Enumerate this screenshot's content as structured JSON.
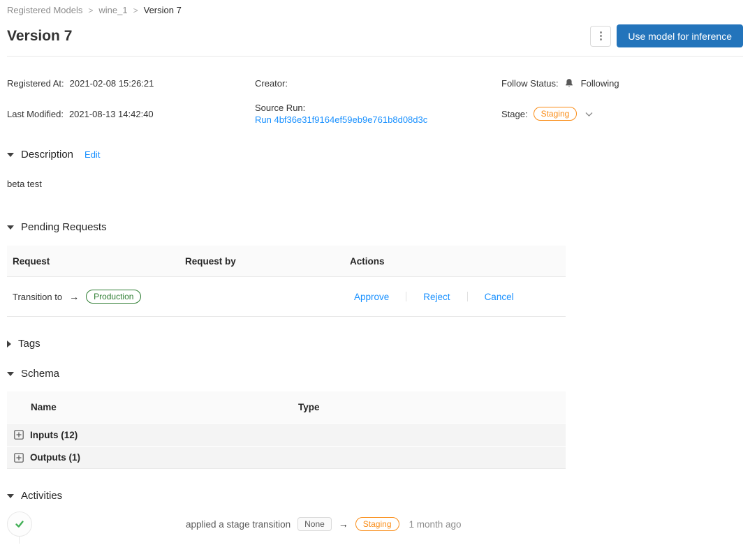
{
  "breadcrumb": {
    "separator": ">",
    "items": [
      {
        "label": "Registered Models"
      },
      {
        "label": "wine_1"
      },
      {
        "label": "Version 7"
      }
    ]
  },
  "header": {
    "title": "Version 7",
    "primary_button_label": "Use model for inference"
  },
  "metadata": {
    "registered_at_label": "Registered At:",
    "registered_at": "2021-02-08 15:26:21",
    "creator_label": "Creator:",
    "creator": "",
    "follow_status_label": "Follow Status:",
    "follow_status": "Following",
    "last_modified_label": "Last Modified:",
    "last_modified": "2021-08-13 14:42:40",
    "source_run_label": "Source Run:",
    "source_run_link": "Run 4bf36e31f9164ef59eb9e761b8d08d3c",
    "stage_label": "Stage:",
    "stage": "Staging"
  },
  "description": {
    "title": "Description",
    "edit_label": "Edit",
    "content": "beta test"
  },
  "pending_requests": {
    "title": "Pending Requests",
    "columns": [
      "Request",
      "Request by",
      "Actions"
    ],
    "rows": [
      {
        "request_text": "Transition to",
        "arrow": "→",
        "target_stage": "Production",
        "request_by": "",
        "actions": [
          "Approve",
          "Reject",
          "Cancel"
        ]
      }
    ]
  },
  "tags": {
    "title": "Tags"
  },
  "schema": {
    "title": "Schema",
    "columns": [
      "Name",
      "Type"
    ],
    "rows": [
      {
        "name": "Inputs (12)",
        "type": ""
      },
      {
        "name": "Outputs (1)",
        "type": ""
      }
    ]
  },
  "activities": {
    "title": "Activities",
    "items": [
      {
        "text": "applied a stage transition",
        "from_stage": "None",
        "arrow": "→",
        "to_stage": "Staging",
        "time": "1 month ago"
      }
    ]
  },
  "colors": {
    "primary_blue": "#2374bb",
    "link_blue": "#1890ff",
    "stage_orange": "#fa8c16",
    "production_green": "#2e7d32",
    "check_green": "#3fae53"
  }
}
